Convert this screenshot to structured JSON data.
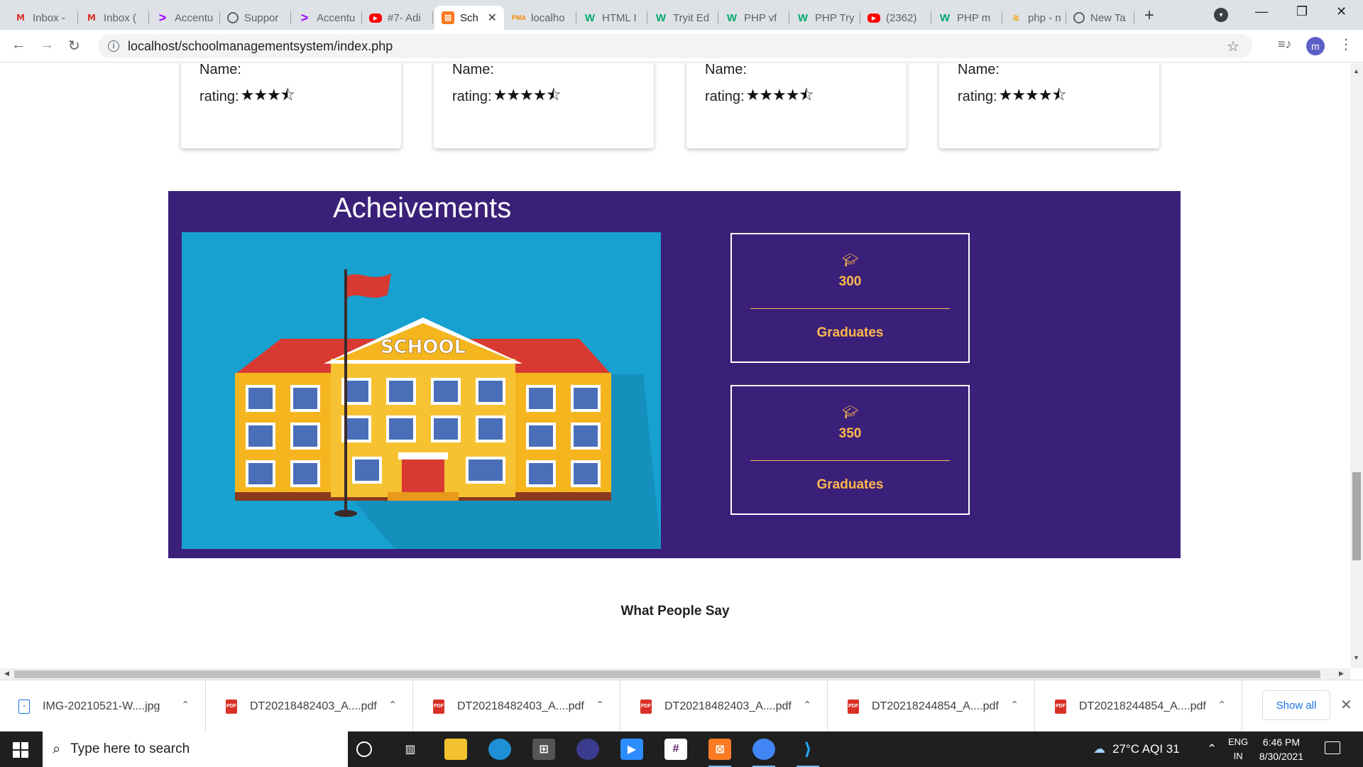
{
  "browser": {
    "tabs": [
      {
        "title": "Inbox -",
        "icon": "gmail-icon",
        "glyph": "M",
        "cls": "fav-gmail"
      },
      {
        "title": "Inbox (",
        "icon": "gmail-icon",
        "glyph": "M",
        "cls": "fav-gmail"
      },
      {
        "title": "Accentu",
        "icon": "accenture-icon",
        "glyph": ">",
        "cls": "fav-accent"
      },
      {
        "title": "Suppor",
        "icon": "globe-icon",
        "glyph": "",
        "cls": "fav-globe"
      },
      {
        "title": "Accentu",
        "icon": "accenture-icon",
        "glyph": ">",
        "cls": "fav-accent"
      },
      {
        "title": "#7- Adi",
        "icon": "youtube-icon",
        "glyph": "▶",
        "cls": "fav-yt"
      },
      {
        "title": "Sch",
        "icon": "xampp-icon",
        "glyph": "⊠",
        "cls": "fav-xampp",
        "active": true
      },
      {
        "title": "localho",
        "icon": "phpmyadmin-icon",
        "glyph": "PMA",
        "cls": "fav-pma"
      },
      {
        "title": "HTML I",
        "icon": "w3schools-icon",
        "glyph": "W",
        "cls": "fav-w3"
      },
      {
        "title": "Tryit Ed",
        "icon": "w3schools-icon",
        "glyph": "W",
        "cls": "fav-w3"
      },
      {
        "title": "PHP vf",
        "icon": "w3schools-icon",
        "glyph": "W",
        "cls": "fav-w3"
      },
      {
        "title": "PHP Try",
        "icon": "w3schools-icon",
        "glyph": "W",
        "cls": "fav-w3"
      },
      {
        "title": "(2362)",
        "icon": "youtube-icon",
        "glyph": "▶",
        "cls": "fav-yt"
      },
      {
        "title": "PHP m",
        "icon": "w3schools-icon",
        "glyph": "W",
        "cls": "fav-w3"
      },
      {
        "title": "php - n",
        "icon": "stackoverflow-icon",
        "glyph": "≋",
        "cls": "fav-php"
      },
      {
        "title": "New Ta",
        "icon": "chrome-icon",
        "glyph": "",
        "cls": "fav-globe"
      }
    ],
    "url": "localhost/schoolmanagementsystem/index.php"
  },
  "ratings": {
    "cards": [
      {
        "name_label": "Name:",
        "rating_label": "rating:",
        "stars": "★★★⯪"
      },
      {
        "name_label": "Name:",
        "rating_label": "rating:",
        "stars": "★★★★⯪"
      },
      {
        "name_label": "Name:",
        "rating_label": "rating:",
        "stars": "★★★★⯪"
      },
      {
        "name_label": "Name:",
        "rating_label": "rating:",
        "stars": "★★★★⯪"
      }
    ]
  },
  "achievements": {
    "title": "Acheivements",
    "school_sign": "SCHOOL",
    "stats": [
      {
        "value": "300",
        "label": "Graduates",
        "icon": "graduation-cap-icon"
      },
      {
        "value": "350",
        "label": "Graduates",
        "icon": "graduation-cap-icon"
      }
    ],
    "colors": {
      "panel": "#3a2078",
      "accent": "#ffb84d",
      "image_bg": "#16a1d0"
    }
  },
  "testimonials": {
    "heading": "What People Say"
  },
  "downloads": {
    "items": [
      {
        "name": "IMG-20210521-W....jpg",
        "type": "img"
      },
      {
        "name": "DT20218482403_A....pdf",
        "type": "pdf"
      },
      {
        "name": "DT20218482403_A....pdf",
        "type": "pdf"
      },
      {
        "name": "DT20218482403_A....pdf",
        "type": "pdf"
      },
      {
        "name": "DT20218244854_A....pdf",
        "type": "pdf"
      },
      {
        "name": "DT20218244854_A....pdf",
        "type": "pdf"
      }
    ],
    "show_all": "Show all"
  },
  "taskbar": {
    "search_placeholder": "Type here to search",
    "weather": "27°C  AQI 31",
    "lang_top": "ENG",
    "lang_bottom": "IN",
    "time": "6:46 PM",
    "date": "8/30/2021"
  }
}
